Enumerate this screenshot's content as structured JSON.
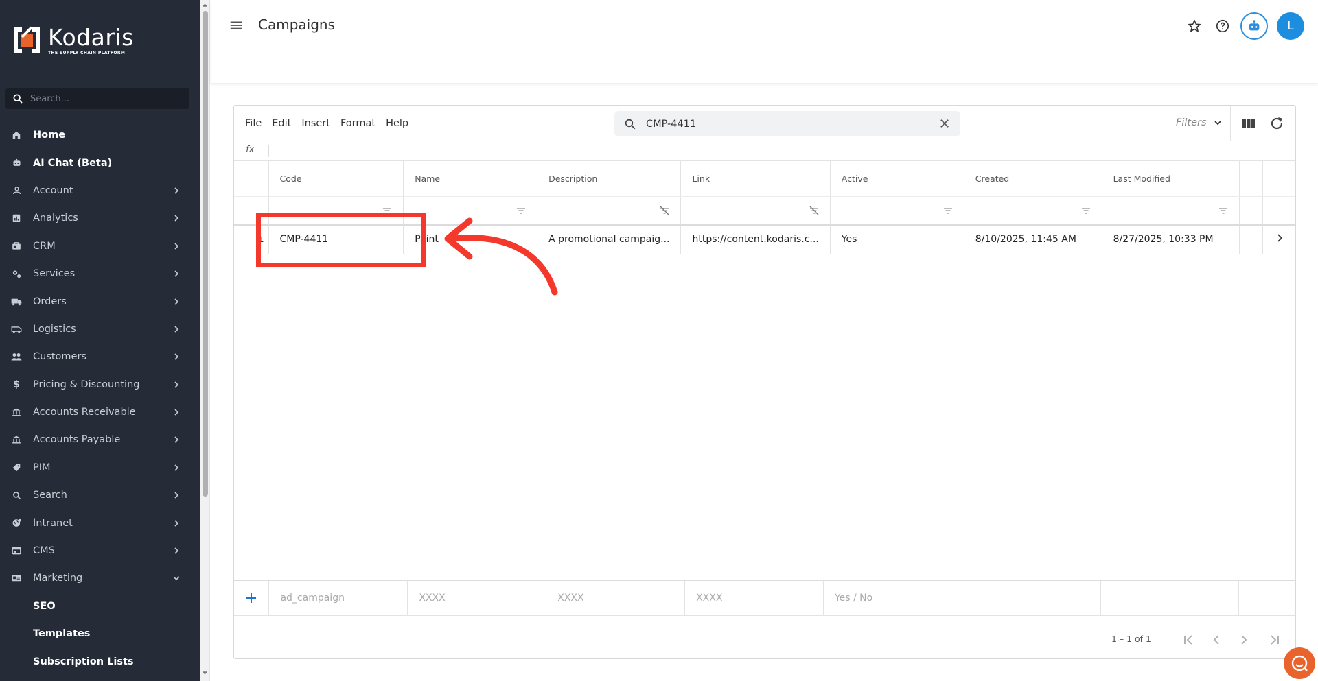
{
  "app": {
    "logo_name": "Kodaris",
    "logo_tagline": "THE SUPPLY CHAIN PLATFORM",
    "brand_color": "#e8642c",
    "accent_color": "#1d8de0"
  },
  "sidebar": {
    "search_placeholder": "Search...",
    "items": [
      {
        "label": "Home",
        "icon": "home-icon",
        "expandable": false
      },
      {
        "label": "AI Chat (Beta)",
        "icon": "robot-icon",
        "expandable": false
      },
      {
        "label": "Account",
        "icon": "person-icon",
        "expandable": true
      },
      {
        "label": "Analytics",
        "icon": "analytics-icon",
        "expandable": true
      },
      {
        "label": "CRM",
        "icon": "crm-icon",
        "expandable": true
      },
      {
        "label": "Services",
        "icon": "gears-icon",
        "expandable": true
      },
      {
        "label": "Orders",
        "icon": "truck-icon",
        "expandable": true
      },
      {
        "label": "Logistics",
        "icon": "van-icon",
        "expandable": true
      },
      {
        "label": "Customers",
        "icon": "people-icon",
        "expandable": true
      },
      {
        "label": "Pricing & Discounting",
        "icon": "dollar-icon",
        "expandable": true
      },
      {
        "label": "Accounts Receivable",
        "icon": "bank-icon",
        "expandable": true
      },
      {
        "label": "Accounts Payable",
        "icon": "bank-icon",
        "expandable": true
      },
      {
        "label": "PIM",
        "icon": "tag-icon",
        "expandable": true
      },
      {
        "label": "Search",
        "icon": "search-icon",
        "expandable": true
      },
      {
        "label": "Intranet",
        "icon": "globe-icon",
        "expandable": true
      },
      {
        "label": "CMS",
        "icon": "cms-icon",
        "expandable": true
      },
      {
        "label": "Marketing",
        "icon": "marketing-icon",
        "expandable": true,
        "expanded": true
      }
    ],
    "sub_items": [
      "SEO",
      "Templates",
      "Subscription Lists"
    ]
  },
  "header": {
    "title": "Campaigns",
    "avatar_initial": "L"
  },
  "grid": {
    "menus": [
      "File",
      "Edit",
      "Insert",
      "Format",
      "Help"
    ],
    "search_value": "CMP-4411",
    "filters_label": "Filters",
    "fx_label": "fx",
    "columns": [
      "Code",
      "Name",
      "Description",
      "Link",
      "Active",
      "Created",
      "Last Modified"
    ],
    "rows": [
      {
        "num": "1",
        "cells": [
          "CMP-4411",
          "Paint",
          "A promotional campaig...",
          "https://content.kodaris.c...",
          "Yes",
          "8/10/2025, 11:45 AM",
          "8/27/2025, 10:33 PM"
        ]
      }
    ],
    "new_row_placeholders": [
      "ad_campaign",
      "XXXX",
      "XXXX",
      "XXXX",
      "Yes / No",
      "",
      ""
    ],
    "pager_text": "1 – 1 of 1"
  },
  "annotation": {
    "color": "#f4392c"
  }
}
